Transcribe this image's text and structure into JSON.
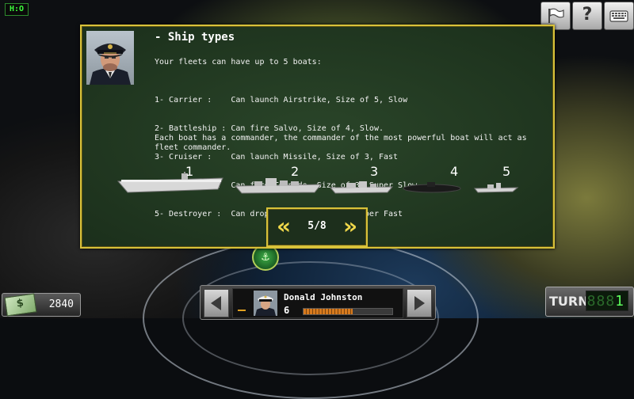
{
  "hud": {
    "logo": "H:O",
    "help_label": "?"
  },
  "panel": {
    "title": "- Ship types",
    "intro": "Your fleets can have up to 5 boats:",
    "ship_types": [
      "1- Carrier :    Can launch Airstrike, Size of 5, Slow",
      "2- Battleship : Can fire Salvo, Size of 4, Slow.",
      "3- Cruiser :    Can launch Missile, Size of 3, Fast",
      "4- Submarine :  Can fire Torpedo, Size of 3, Super Slow",
      "5- Destroyer :  Can drop Mine, Size of 2, Super Fast"
    ],
    "note": "Each boat has a commander, the commander of the most powerful boat will act as fleet commander.",
    "ship_numbers": [
      "1",
      "2",
      "3",
      "4",
      "5"
    ]
  },
  "pager": {
    "prev_label": "«",
    "page": "5/8",
    "next_label": "»"
  },
  "money": {
    "amount": "2840"
  },
  "commander": {
    "name": "Donald Johnston",
    "level": "6",
    "xp_fraction": 0.55
  },
  "turn": {
    "label": "TURN",
    "counter_dim": "888",
    "counter_current": "1"
  },
  "colors": {
    "panel_border": "#d8c23a",
    "panel_bg": "#1f3520",
    "turn_lcd": "#5dff5d"
  }
}
